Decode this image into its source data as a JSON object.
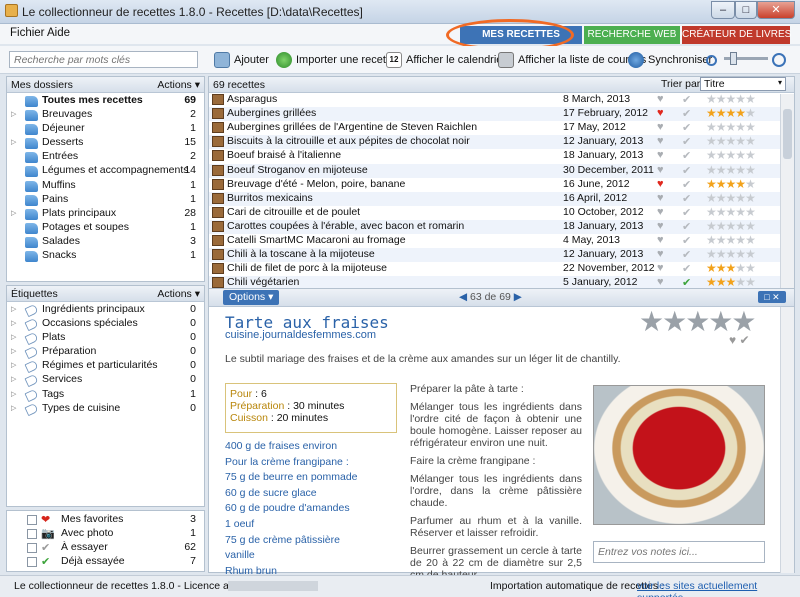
{
  "window": {
    "title": "Le collectionneur de recettes 1.8.0 - Recettes [D:\\data\\Recettes]",
    "minimize": "–",
    "maximize": "□",
    "close": "✕"
  },
  "menu": [
    "Fichier",
    "Aide"
  ],
  "tabs": [
    {
      "label": "MES RECETTES",
      "color": "#3d73b6"
    },
    {
      "label": "RECHERCHE WEB",
      "color": "#4caf50"
    },
    {
      "label": "CRÉATEUR DE LIVRES",
      "color": "#c0392b"
    }
  ],
  "search": {
    "placeholder": "Recherche par mots clés"
  },
  "toolbar": {
    "add": "Ajouter",
    "import": "Importer une recette",
    "calendar": "Afficher le calendrier",
    "calendar_day": "12",
    "shopping": "Afficher la liste de courses",
    "sync": "Synchroniser",
    "zoom_level": 0.15
  },
  "folders": {
    "title": "Mes dossiers",
    "actions": "Actions",
    "items": [
      {
        "label": "Toutes mes recettes",
        "count": "69",
        "arrow": "",
        "bold": true
      },
      {
        "label": "Breuvages",
        "count": "2",
        "arrow": "▷"
      },
      {
        "label": "Déjeuner",
        "count": "1",
        "arrow": ""
      },
      {
        "label": "Desserts",
        "count": "15",
        "arrow": "▷"
      },
      {
        "label": "Entrées",
        "count": "2",
        "arrow": ""
      },
      {
        "label": "Légumes et accompagnements",
        "count": "14",
        "arrow": ""
      },
      {
        "label": "Muffins",
        "count": "1",
        "arrow": ""
      },
      {
        "label": "Pains",
        "count": "1",
        "arrow": ""
      },
      {
        "label": "Plats principaux",
        "count": "28",
        "arrow": "▷"
      },
      {
        "label": "Potages et soupes",
        "count": "1",
        "arrow": ""
      },
      {
        "label": "Salades",
        "count": "3",
        "arrow": ""
      },
      {
        "label": "Snacks",
        "count": "1",
        "arrow": ""
      }
    ]
  },
  "tags": {
    "title": "Étiquettes",
    "actions": "Actions",
    "items": [
      {
        "label": "Ingrédients principaux",
        "count": "0"
      },
      {
        "label": "Occasions spéciales",
        "count": "0"
      },
      {
        "label": "Plats",
        "count": "0"
      },
      {
        "label": "Préparation",
        "count": "0"
      },
      {
        "label": "Régimes et particularités",
        "count": "0"
      },
      {
        "label": "Services",
        "count": "0"
      },
      {
        "label": "Tags",
        "count": "1"
      },
      {
        "label": "Types de cuisine",
        "count": "0"
      }
    ]
  },
  "favorites": [
    {
      "label": "Mes favorites",
      "count": "3",
      "icon": "❤",
      "icon_name": "heart-icon"
    },
    {
      "label": "Avec photo",
      "count": "1",
      "icon": "📷",
      "icon_name": "camera-icon"
    },
    {
      "label": "À essayer",
      "count": "62",
      "icon": "✔",
      "icon_name": "check-gray-icon"
    },
    {
      "label": "Déjà essayée",
      "count": "7",
      "icon": "✔",
      "icon_name": "check-green-icon"
    }
  ],
  "list": {
    "count_label": "69 recettes",
    "sort_label": "Trier par :",
    "sort_value": "Titre",
    "rows": [
      {
        "name": "Asparagus",
        "date": "8 March, 2013",
        "fav": false,
        "tried": false,
        "stars": 0
      },
      {
        "name": "Aubergines grillées",
        "date": "17 February, 2012",
        "fav": true,
        "tried": false,
        "stars": 4
      },
      {
        "name": "Aubergines grillées de l'Argentine de Steven Raichlen",
        "date": "17 May, 2012",
        "fav": false,
        "tried": false,
        "stars": 0
      },
      {
        "name": "Biscuits à la citrouille et aux pépites de chocolat noir",
        "date": "12 January, 2013",
        "fav": false,
        "tried": false,
        "stars": 0
      },
      {
        "name": "Boeuf braisé à l'italienne",
        "date": "18 January, 2013",
        "fav": false,
        "tried": false,
        "stars": 0
      },
      {
        "name": "Boeuf Stroganov en mijoteuse",
        "date": "30 December, 2011",
        "fav": false,
        "tried": false,
        "stars": 0
      },
      {
        "name": "Breuvage d'été - Melon, poire, banane",
        "date": "16 June, 2012",
        "fav": true,
        "tried": false,
        "stars": 4
      },
      {
        "name": "Burritos mexicains",
        "date": "16 April, 2012",
        "fav": false,
        "tried": false,
        "stars": 0
      },
      {
        "name": "Cari de citrouille et de poulet",
        "date": "10 October, 2012",
        "fav": false,
        "tried": false,
        "stars": 0
      },
      {
        "name": "Carottes coupées à l'érable, avec bacon et romarin",
        "date": "18 January, 2013",
        "fav": false,
        "tried": false,
        "stars": 0
      },
      {
        "name": "Catelli SmartMC Macaroni au fromage",
        "date": "4 May, 2013",
        "fav": false,
        "tried": false,
        "stars": 0
      },
      {
        "name": "Chili à la toscane à la mijoteuse",
        "date": "12 January, 2013",
        "fav": false,
        "tried": false,
        "stars": 0
      },
      {
        "name": "Chili de filet de porc à la mijoteuse",
        "date": "22 November, 2012",
        "fav": false,
        "tried": false,
        "stars": 3
      },
      {
        "name": "Chili végétarien",
        "date": "5 January, 2012",
        "fav": false,
        "tried": true,
        "stars": 3
      }
    ]
  },
  "detail": {
    "options": "Options ▾",
    "pager": "63 de 69",
    "title": "Tarte aux fraises",
    "source": "cuisine.journaldesfemmes.com",
    "description": "Le subtil mariage des fraises et de la crème aux amandes sur un léger lit de chantilly.",
    "yield_label": "Pour",
    "yield_value": "6",
    "prep_label": "Préparation",
    "prep_value": "30 minutes",
    "cook_label": "Cuisson",
    "cook_value": "20 minutes",
    "ingredients": [
      "400 g de fraises environ",
      "Pour la crème frangipane :",
      "75 g de beurre en pommade",
      "60 g de sucre glace",
      "60 g de poudre d'amandes",
      "1 oeuf",
      "75 g de crème pâtissière",
      "vanille",
      "Rhum brun"
    ],
    "steps": [
      "Préparer la pâte à tarte :",
      "Mélanger tous les ingrédients dans l'ordre cité de façon à obtenir une boule homogène. Laisser reposer au réfrigérateur environ une nuit.",
      "Faire la crème frangipane :",
      "Mélanger tous les ingrédients dans l'ordre, dans la crème pâtissière chaude.",
      "Parfumer au rhum et à la vanille. Réserver et laisser refroidir.",
      "Beurrer grassement un cercle à tarte de 20 à 22 cm de diamètre sur 2,5 cm de hauteur"
    ],
    "notes_placeholder": "Entrez vos notes ici..."
  },
  "status": {
    "left": "Le collectionneur de recettes 1.8.0 - Licence accordée à",
    "right_label": "Importation automatique de recettes :",
    "right_link": "voir les sites actuellement supportés"
  }
}
